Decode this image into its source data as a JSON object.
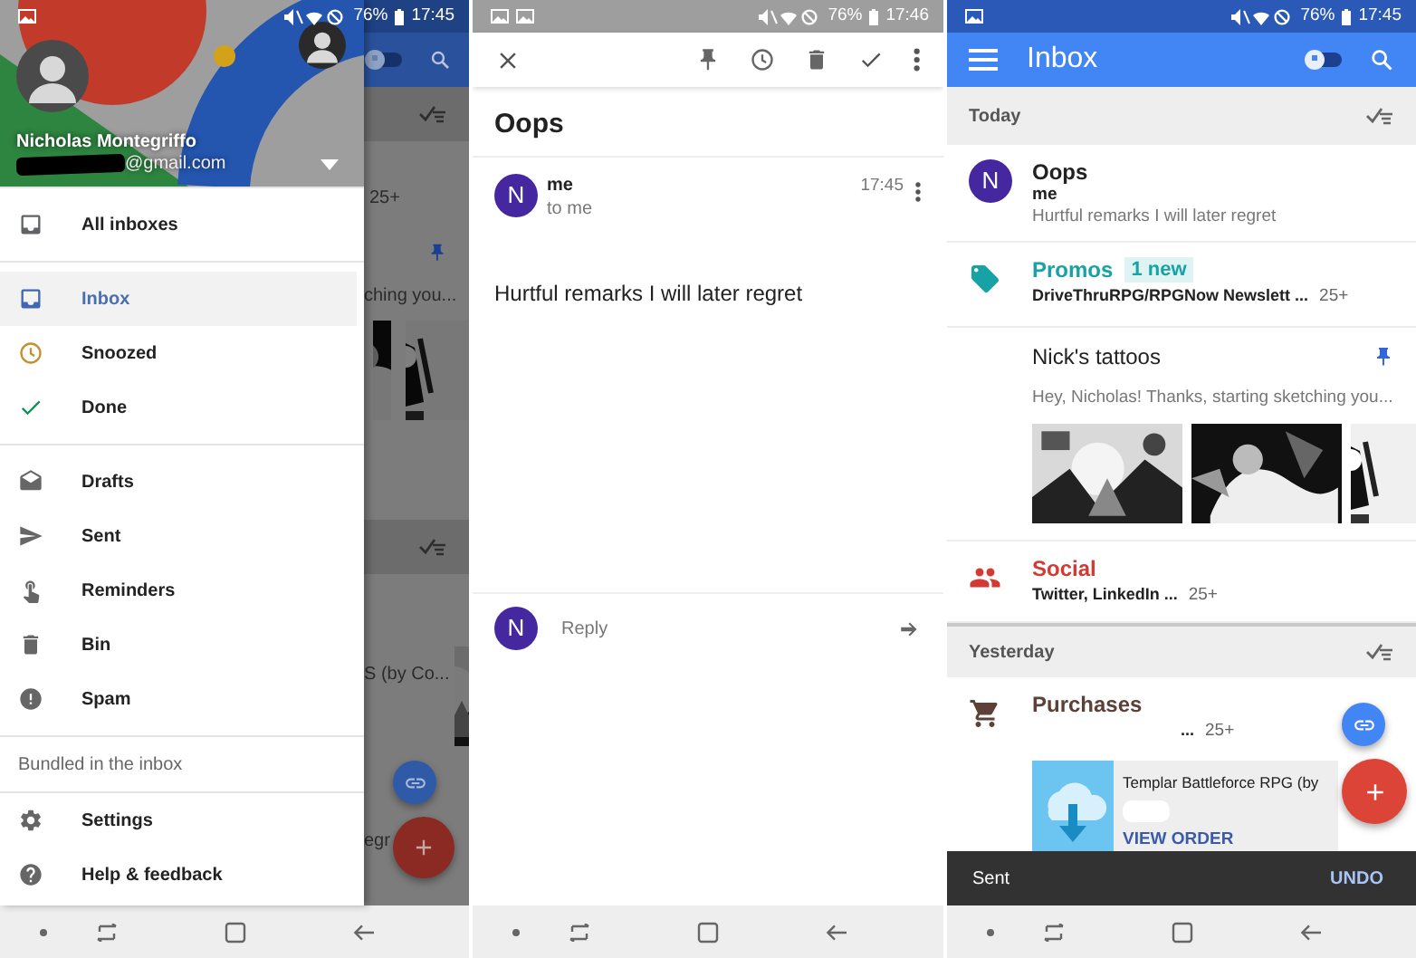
{
  "drawer_screen": {
    "status_bar": {
      "battery": "76%",
      "time": "17:45"
    },
    "account": {
      "name": "Nicholas Montegriffo",
      "email": "@gmail.com"
    },
    "menu_groups": [
      {
        "items": [
          {
            "label": "All inboxes",
            "selected": false
          }
        ]
      },
      {
        "items": [
          {
            "label": "Inbox",
            "selected": true
          },
          {
            "label": "Snoozed",
            "selected": false
          },
          {
            "label": "Done",
            "selected": false
          }
        ]
      },
      {
        "items": [
          {
            "label": "Drafts",
            "selected": false
          },
          {
            "label": "Sent",
            "selected": false
          },
          {
            "label": "Reminders",
            "selected": false
          },
          {
            "label": "Bin",
            "selected": false
          },
          {
            "label": "Spam",
            "selected": false
          }
        ]
      },
      {
        "heading": "Bundled in the inbox"
      },
      {
        "items": [
          {
            "label": "Settings",
            "selected": false
          },
          {
            "label": "Help & feedback",
            "selected": false
          }
        ]
      }
    ],
    "background_fragments": [
      "25+",
      "ching you...",
      "S (by Co...",
      "egr"
    ],
    "background_pinned_only": false
  },
  "message_screen": {
    "status_bar": {
      "battery": "76%",
      "time": "17:46"
    },
    "subject": "Oops",
    "message": {
      "initial": "N",
      "sender": "me",
      "recipient": "to me",
      "time": "17:45",
      "body": "Hurtful remarks I will later regret"
    },
    "reply": {
      "initial": "N",
      "placeholder": "Reply"
    }
  },
  "inbox_screen": {
    "status_bar": {
      "battery": "76%",
      "time": "17:45"
    },
    "app_bar": {
      "title": "Inbox",
      "pinned_only": false
    },
    "sections": [
      {
        "label": "Today",
        "items": [
          {
            "kind": "email",
            "initial": "N",
            "subject": "Oops",
            "sender": "me",
            "snippet": "Hurtful remarks I will later regret"
          },
          {
            "kind": "bundle",
            "name": "Promos",
            "badge": "1 new",
            "senders": "DriveThruRPG/RPGNow Newslett ...",
            "count": "25+",
            "color": "#17a2a6"
          },
          {
            "kind": "thread",
            "subject": "Nick's tattoos",
            "pinned": true,
            "snippet": "Hey, Nicholas! Thanks, starting sketching you..."
          },
          {
            "kind": "bundle",
            "name": "Social",
            "senders": "Twitter, LinkedIn ...",
            "count": "25+",
            "color": "#d23a34"
          }
        ]
      },
      {
        "label": "Yesterday",
        "items": [
          {
            "kind": "bundle",
            "name": "Purchases",
            "senders": "...",
            "count": "25+",
            "color": "#5d4037",
            "card": {
              "title": "Templar Battleforce RPG (by",
              "action": "VIEW ORDER"
            }
          }
        ]
      }
    ],
    "snackbar": {
      "message": "Sent",
      "action": "UNDO"
    }
  }
}
